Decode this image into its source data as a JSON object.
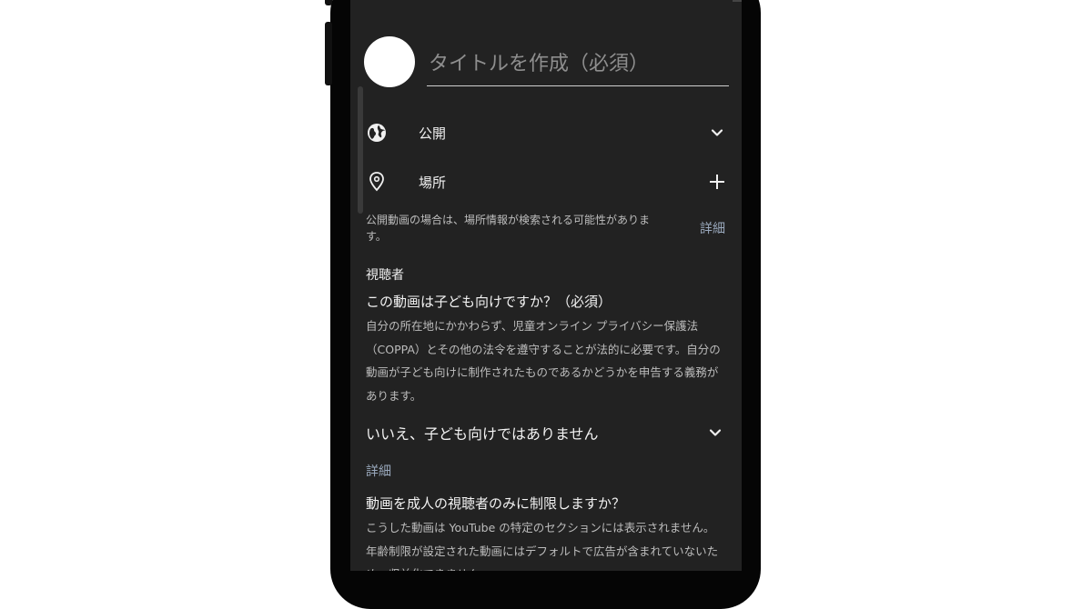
{
  "form": {
    "title_placeholder": "タイトルを作成（必須）",
    "title_value": ""
  },
  "visibility": {
    "label": "公開",
    "icon": "globe-icon",
    "trailing_icon": "chevron-down-icon"
  },
  "location": {
    "label": "場所",
    "icon": "location-pin-icon",
    "trailing_icon": "plus-icon",
    "note": "公開動画の場合は、場所情報が検索される可能性があります。",
    "details_link": "詳細"
  },
  "audience": {
    "heading": "視聴者",
    "question": "この動画は子ども向けですか？（必須）",
    "description": "自分の所在地にかかわらず、児童オンライン プライバシー保護法（COPPA）とその他の法令を遵守することが法的に必要です。自分の動画が子ども向けに制作されたものであるかどうかを申告する義務があります。",
    "selected_option": "いいえ、子ども向けではありません",
    "details_link": "詳細"
  },
  "age_restriction": {
    "question": "動画を成人の視聴者のみに制限しますか？",
    "description": "こうした動画は YouTube の特定のセクションには表示されません。年齢制限が設定された動画にはデフォルトで広告が含まれていないため、収益化できません。"
  },
  "colors": {
    "screen_bg": "#222222",
    "link": "#9aa9bd",
    "muted_text": "#bdbdbd"
  }
}
